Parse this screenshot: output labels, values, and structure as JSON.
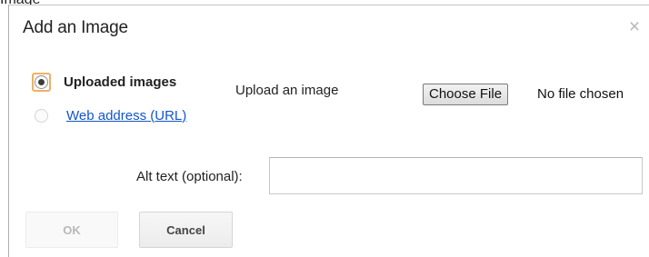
{
  "dialog": {
    "background_title_fragment": "Image",
    "title": "Add an Image",
    "close_glyph": "×",
    "close_icon": "close-icon",
    "sources": [
      {
        "label": "Uploaded images",
        "selected": true
      },
      {
        "label": "Web address (URL)",
        "selected": false
      }
    ],
    "upload": {
      "label": "Upload an image",
      "button_label": "Choose File",
      "status": "No file chosen"
    },
    "alt_text": {
      "label": "Alt text (optional):",
      "value": ""
    },
    "buttons": {
      "ok": "OK",
      "cancel": "Cancel"
    }
  },
  "colors": {
    "link": "#1155cc",
    "focus_ring": "#f0b063",
    "disabled_text": "#b8b8b8"
  }
}
